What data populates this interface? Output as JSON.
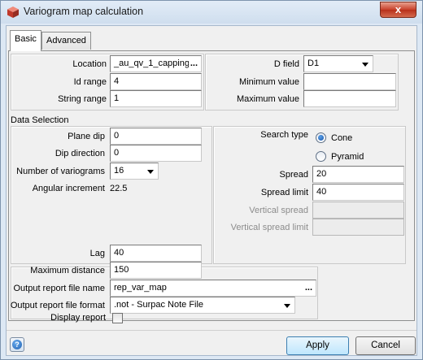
{
  "window": {
    "title": "Variogram map calculation",
    "close_symbol": "x",
    "app_icon": "red-cube-icon"
  },
  "tabs": [
    {
      "label": "Basic",
      "active": true
    },
    {
      "label": "Advanced",
      "active": false
    }
  ],
  "location_group": {
    "location_label": "Location",
    "location_value": "_au_qv_1_capping",
    "location_browse": "...",
    "id_range_label": "Id range",
    "id_range_value": "4",
    "string_range_label": "String range",
    "string_range_value": "1"
  },
  "dfield_group": {
    "dfield_label": "D field",
    "dfield_value": "D1",
    "minimum_label": "Minimum value",
    "minimum_value": "",
    "maximum_label": "Maximum value",
    "maximum_value": ""
  },
  "data_selection": {
    "section_label": "Data Selection",
    "plane_dip_label": "Plane dip",
    "plane_dip_value": "0",
    "dip_direction_label": "Dip direction",
    "dip_direction_value": "0",
    "num_variograms_label": "Number of variograms",
    "num_variograms_value": "16",
    "angular_increment_label": "Angular increment",
    "angular_increment_value": "22.5"
  },
  "search": {
    "search_type_label": "Search type",
    "options": [
      {
        "label": "Cone",
        "checked": true
      },
      {
        "label": "Pyramid",
        "checked": false
      }
    ],
    "spread_label": "Spread",
    "spread_value": "20",
    "spread_limit_label": "Spread limit",
    "spread_limit_value": "40",
    "vertical_spread_label": "Vertical spread",
    "vertical_spread_value": "",
    "vertical_spread_limit_label": "Vertical spread limit",
    "vertical_spread_limit_value": ""
  },
  "output": {
    "lag_label": "Lag",
    "lag_value": "40",
    "max_distance_label": "Maximum distance",
    "max_distance_value": "150",
    "report_name_label": "Output report file name",
    "report_name_value": "rep_var_map",
    "report_name_browse": "...",
    "report_format_label": "Output report file format",
    "report_format_value": ".not - Surpac Note File",
    "display_report_label": "Display report",
    "display_report_checked": false
  },
  "footer": {
    "help_symbol": "?",
    "apply_label": "Apply",
    "cancel_label": "Cancel"
  }
}
